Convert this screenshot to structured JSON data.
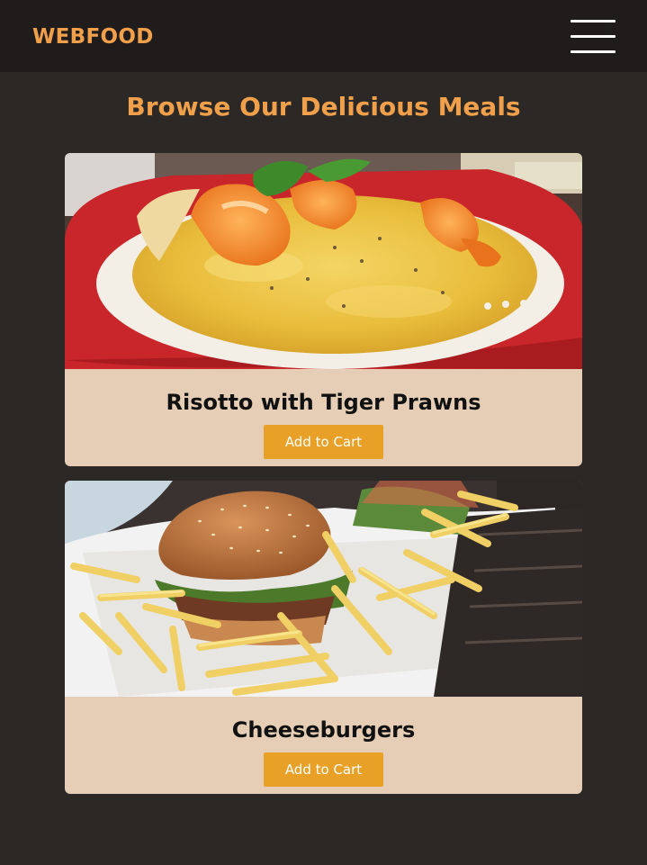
{
  "navbar": {
    "brand": "WEBFOOD",
    "menu_icon": "hamburger-menu-icon"
  },
  "page": {
    "heading": "Browse Our Delicious Meals"
  },
  "meals": [
    {
      "title": "Risotto with Tiger Prawns",
      "button_label": "Add to Cart",
      "image": "risotto-with-prawns-photo"
    },
    {
      "title": "Cheeseburgers",
      "button_label": "Add to Cart",
      "image": "cheeseburger-with-fries-photo"
    }
  ],
  "colors": {
    "page_background": "#2b2826",
    "navbar_background": "#1f1c1b",
    "brand_accent": "#f0a04b",
    "card_background": "#e5ceb5",
    "button_background": "#e8a027",
    "button_text": "#ffffff"
  }
}
